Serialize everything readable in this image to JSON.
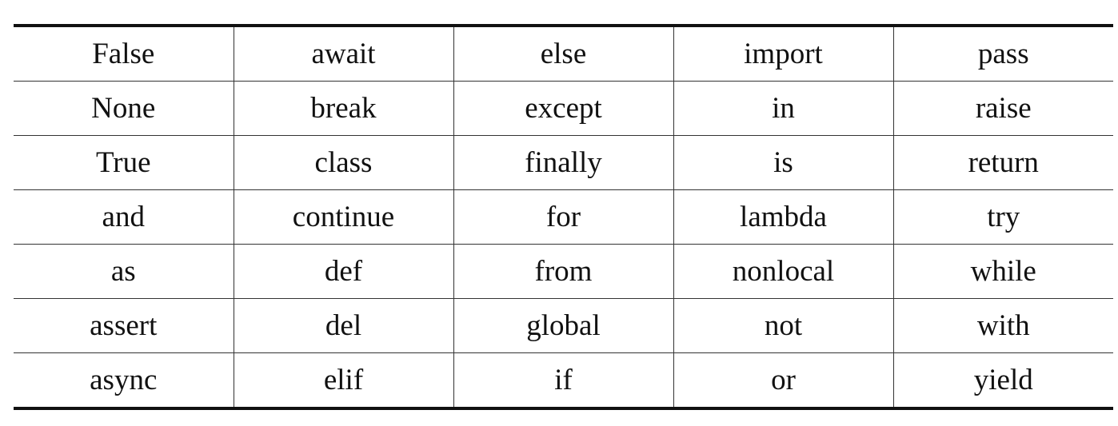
{
  "table": {
    "rows": [
      [
        "False",
        "await",
        "else",
        "import",
        "pass"
      ],
      [
        "None",
        "break",
        "except",
        "in",
        "raise"
      ],
      [
        "True",
        "class",
        "finally",
        "is",
        "return"
      ],
      [
        "and",
        "continue",
        "for",
        "lambda",
        "try"
      ],
      [
        "as",
        "def",
        "from",
        "nonlocal",
        "while"
      ],
      [
        "assert",
        "del",
        "global",
        "not",
        "with"
      ],
      [
        "async",
        "elif",
        "if",
        "or",
        "yield"
      ]
    ]
  }
}
